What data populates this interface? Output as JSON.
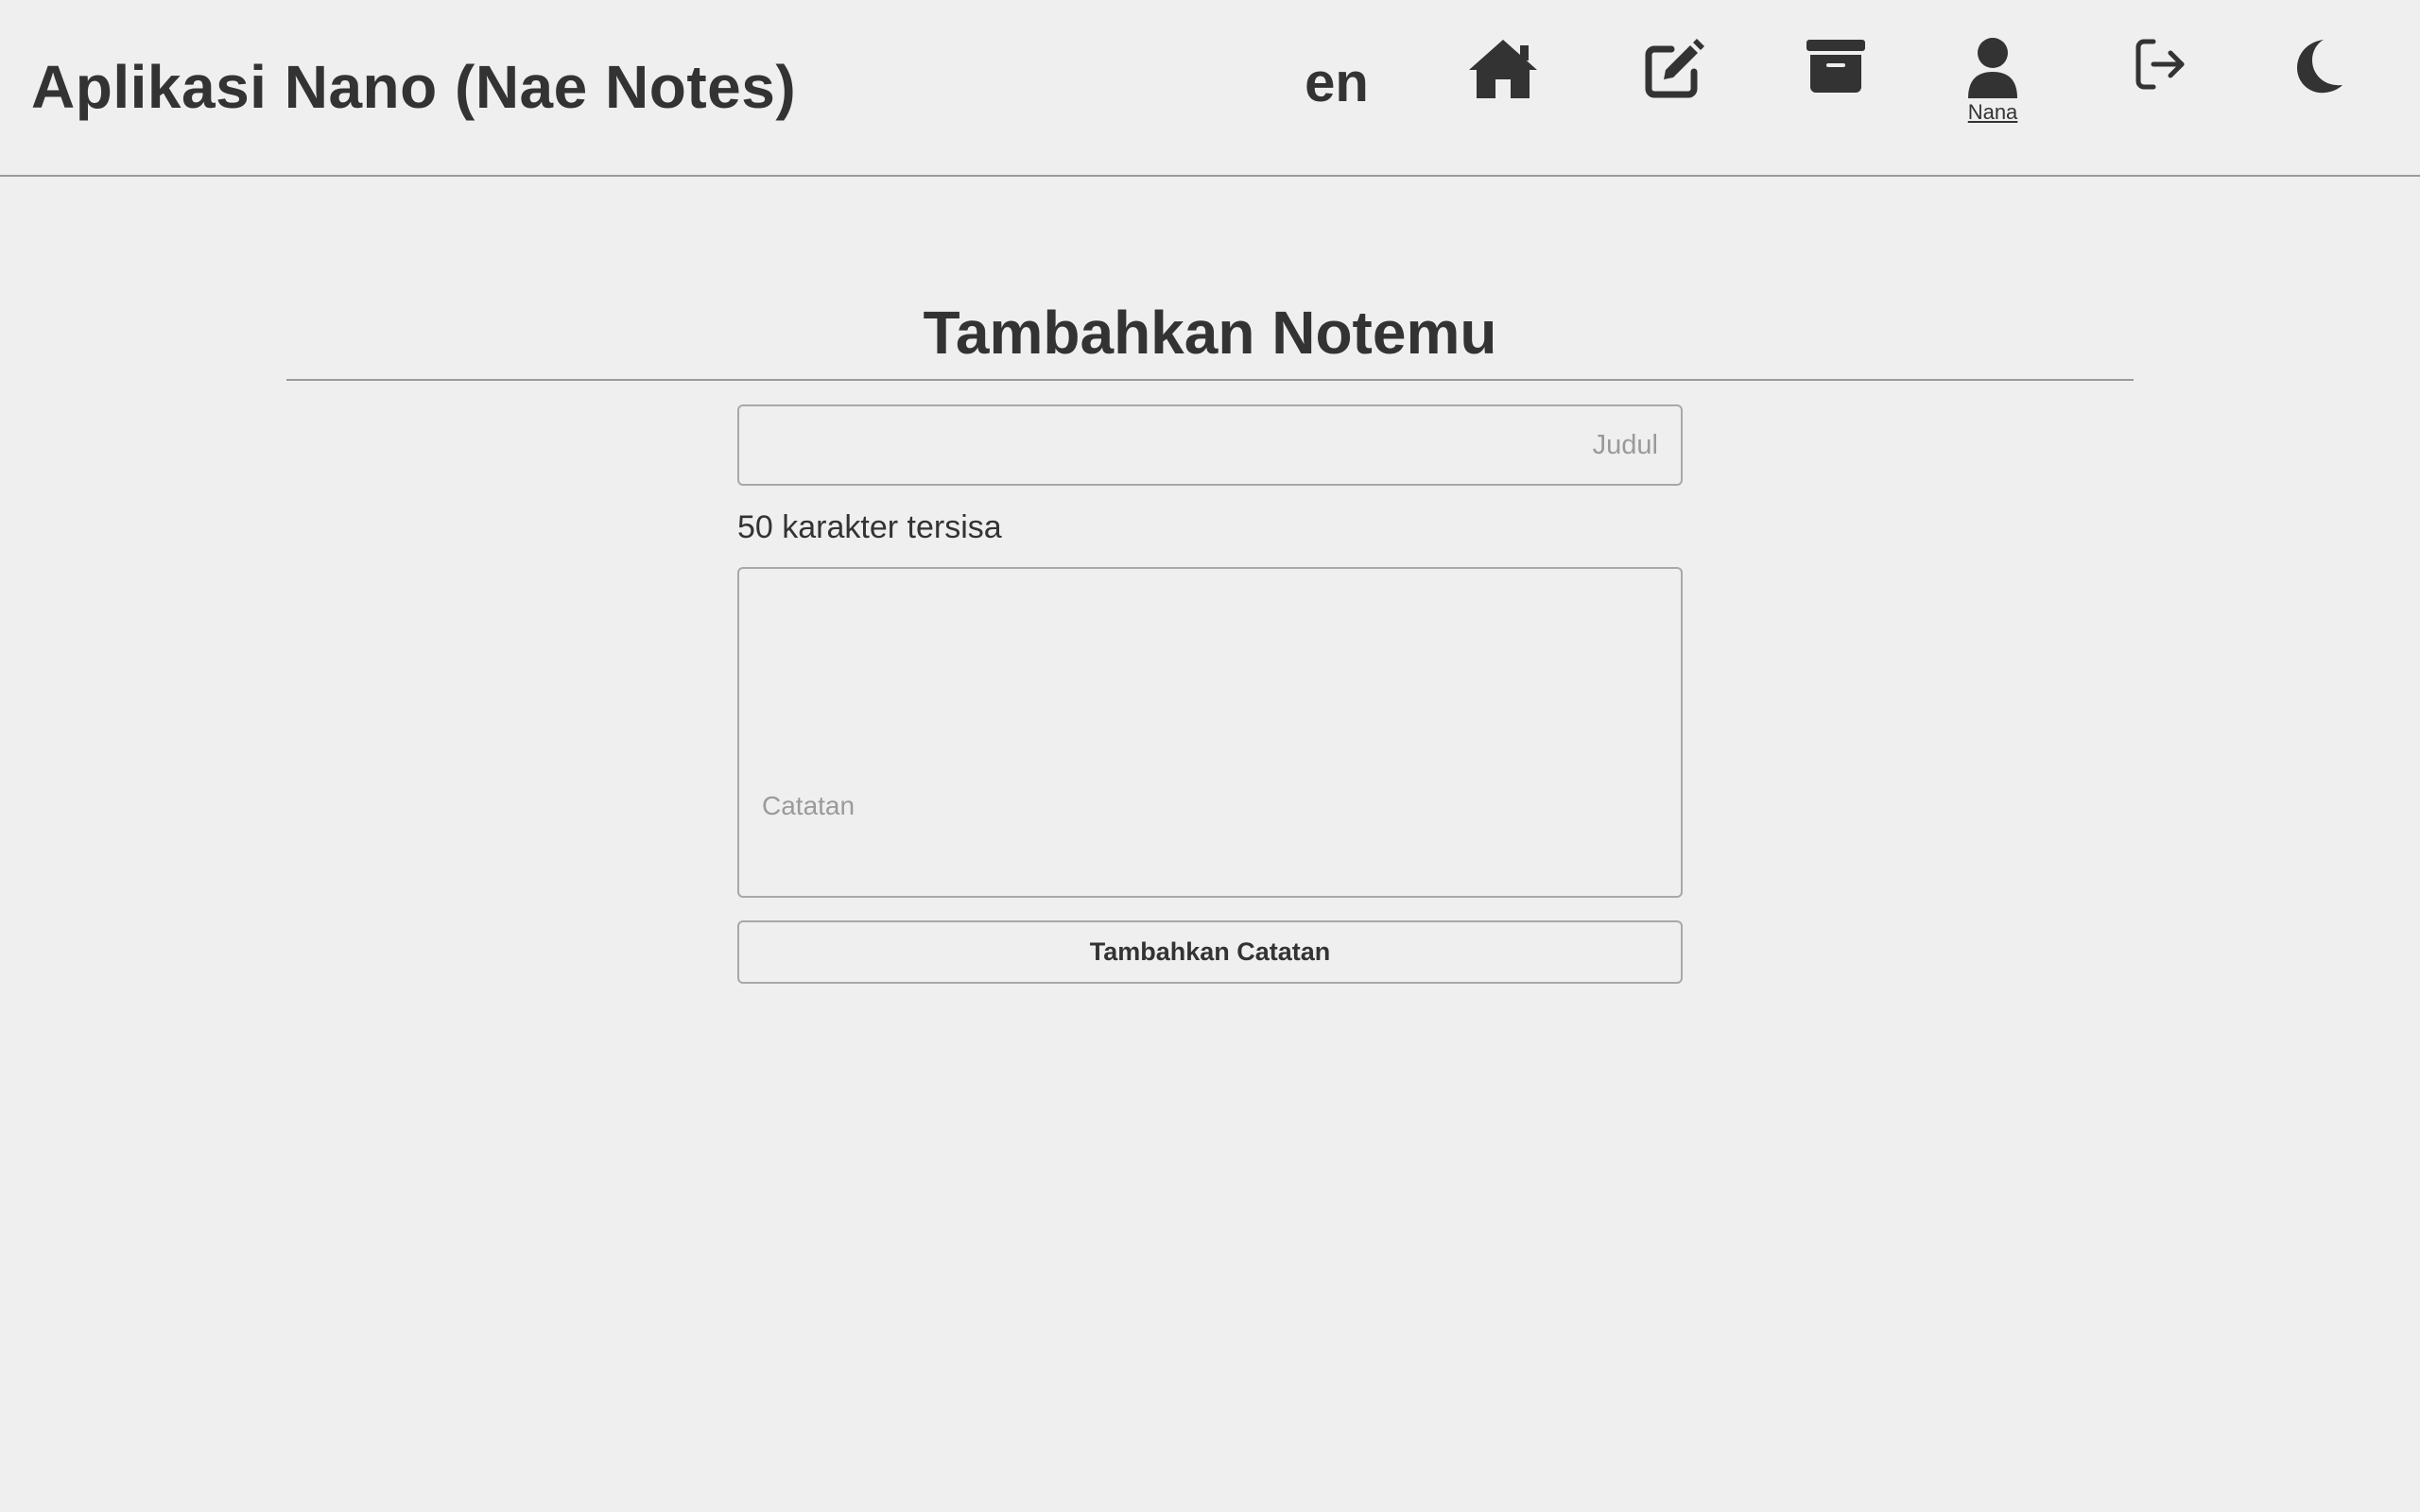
{
  "header": {
    "app_title": "Aplikasi Nano (Nae Notes)",
    "language": "en",
    "nav": [
      {
        "icon": "home-icon"
      },
      {
        "icon": "edit-icon"
      },
      {
        "icon": "archive-icon"
      },
      {
        "icon": "user-icon",
        "label": "Nana"
      },
      {
        "icon": "logout-icon"
      },
      {
        "icon": "moon-icon"
      }
    ],
    "user_name": "Nana"
  },
  "main": {
    "page_title": "Tambahkan Notemu",
    "title_input": {
      "value": "",
      "placeholder": "Judul"
    },
    "char_count_text": "50 karakter tersisa",
    "note_input": {
      "value": "",
      "placeholder": "Catatan"
    },
    "submit_label": "Tambahkan Catatan"
  },
  "colors": {
    "background": "#efefef",
    "text": "#333333",
    "border": "#a8a8a8",
    "placeholder": "#9a9a9a"
  }
}
